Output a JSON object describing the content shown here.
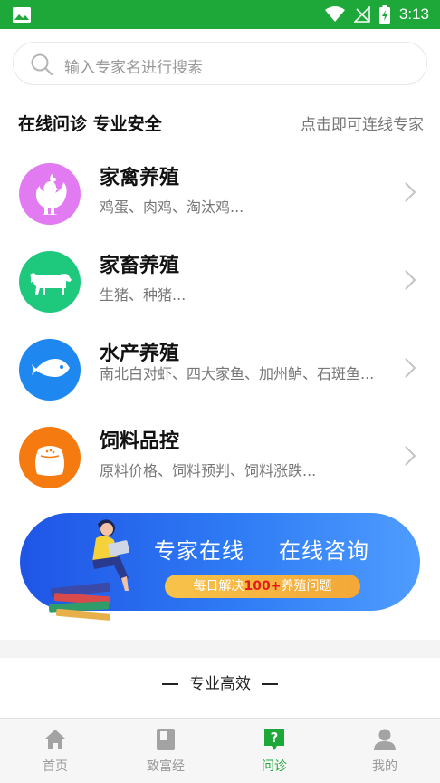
{
  "status_bar": {
    "time": "3:13"
  },
  "search": {
    "placeholder": "输入专家名进行搜素"
  },
  "section": {
    "title": "在线问诊 专业安全",
    "hint": "点击即可连线专家"
  },
  "categories": [
    {
      "name": "家禽养殖",
      "desc": "鸡蛋、肉鸡、淘汰鸡...",
      "icon": "chicken-icon",
      "color": "#e27bf1"
    },
    {
      "name": "家畜养殖",
      "desc": "生猪、种猪...",
      "icon": "cow-icon",
      "color": "#1ec97e"
    },
    {
      "name": "水产养殖",
      "desc": "南北白对虾、四大家鱼、加州鲈、石斑鱼...",
      "icon": "fish-icon",
      "color": "#1f87f0"
    },
    {
      "name": "饲料品控",
      "desc": "原料价格、饲料预判、饲料涨跌...",
      "icon": "feed-bag-icon",
      "color": "#f57a0f"
    }
  ],
  "banner": {
    "title_left": "专家在线",
    "title_right": "在线咨询",
    "pill_prefix": "每日解决",
    "pill_highlight": "100+",
    "pill_suffix": "养殖问题"
  },
  "subsection": {
    "title": "专业高效"
  },
  "tabbar": {
    "tabs": [
      {
        "label": "首页",
        "icon": "home-icon"
      },
      {
        "label": "致富经",
        "icon": "book-icon"
      },
      {
        "label": "问诊",
        "icon": "question-icon",
        "active": true
      },
      {
        "label": "我的",
        "icon": "user-icon"
      }
    ]
  },
  "colors": {
    "brand_green": "#1ea83a",
    "banner_blue": "#2f7cf5",
    "pill_orange": "#f4a736"
  }
}
